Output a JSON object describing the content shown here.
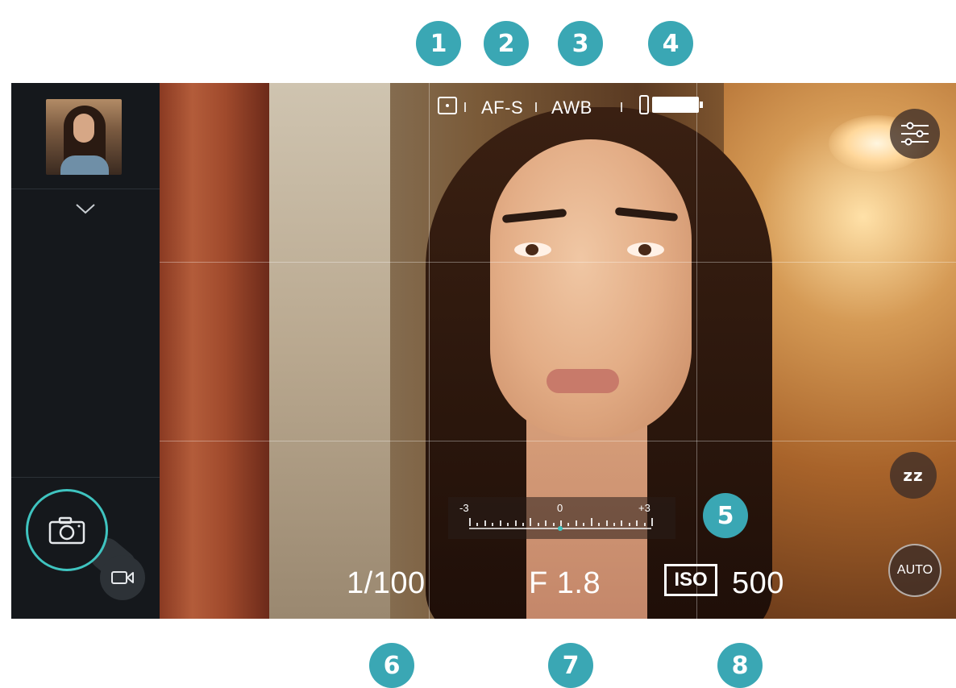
{
  "markers": {
    "m1": "1",
    "m2": "2",
    "m3": "3",
    "m4": "4",
    "m5": "5",
    "m6": "6",
    "m7": "7",
    "m8": "8"
  },
  "status_bar": {
    "metering_icon": "spot-metering-icon",
    "focus_mode": "AF-S",
    "white_balance": "AWB",
    "battery_icon": "battery-icon"
  },
  "sidebar": {
    "thumbnail": "last-photo-thumbnail",
    "expand_icon": "chevron-down-icon",
    "shutter_icon": "camera-icon",
    "video_icon": "video-camera-icon"
  },
  "controls": {
    "settings_icon": "sliders-icon",
    "sleep_label": "zz",
    "auto_label": "AUTO"
  },
  "exposure_scale": {
    "min_label": "-3",
    "mid_label": "0",
    "max_label": "+3",
    "value": 0
  },
  "exposure": {
    "shutter_speed": "1/100",
    "aperture": "F 1.8",
    "iso_label": "ISO",
    "iso_value": "500"
  },
  "colors": {
    "marker": "#3aa7b4",
    "accent": "#3fc4c0",
    "panel": "#15181c"
  }
}
